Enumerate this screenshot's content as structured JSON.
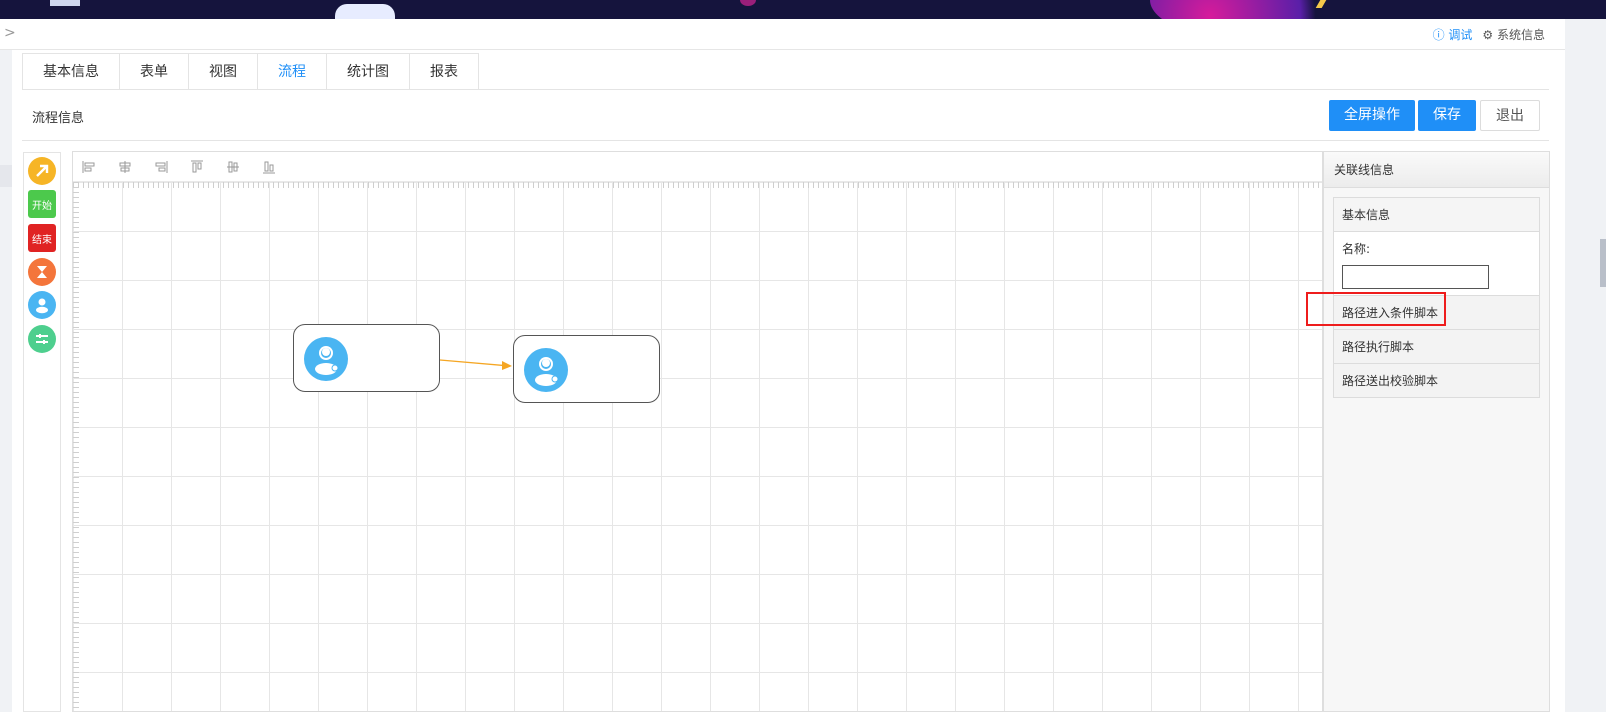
{
  "header": {
    "collapse_icon": ">",
    "debug_label": "ⓘ 调试",
    "sysinfo_label": "⚙ 系统信息"
  },
  "tabs": [
    {
      "label": "基本信息",
      "active": false
    },
    {
      "label": "表单",
      "active": false
    },
    {
      "label": "视图",
      "active": false
    },
    {
      "label": "流程",
      "active": true
    },
    {
      "label": "统计图",
      "active": false
    },
    {
      "label": "报表",
      "active": false
    }
  ],
  "section": {
    "title": "流程信息",
    "fullscreen_label": "全屏操作",
    "save_label": "保存",
    "exit_label": "退出"
  },
  "palette": {
    "start_label": "开始",
    "end_label": "结束"
  },
  "info_panel": {
    "title": "关联线信息",
    "basic_section": "基本信息",
    "name_label": "名称:",
    "name_value": "",
    "items": [
      "路径进入条件脚本",
      "路径执行脚本",
      "路径送出校验脚本"
    ]
  },
  "colors": {
    "primary": "#1f8ff7",
    "start_green": "#4cc94c",
    "end_red": "#e02323",
    "arrow_orange": "#f5a623",
    "user_blue": "#4ab5f2",
    "highlight_red": "#ee1c1c"
  }
}
